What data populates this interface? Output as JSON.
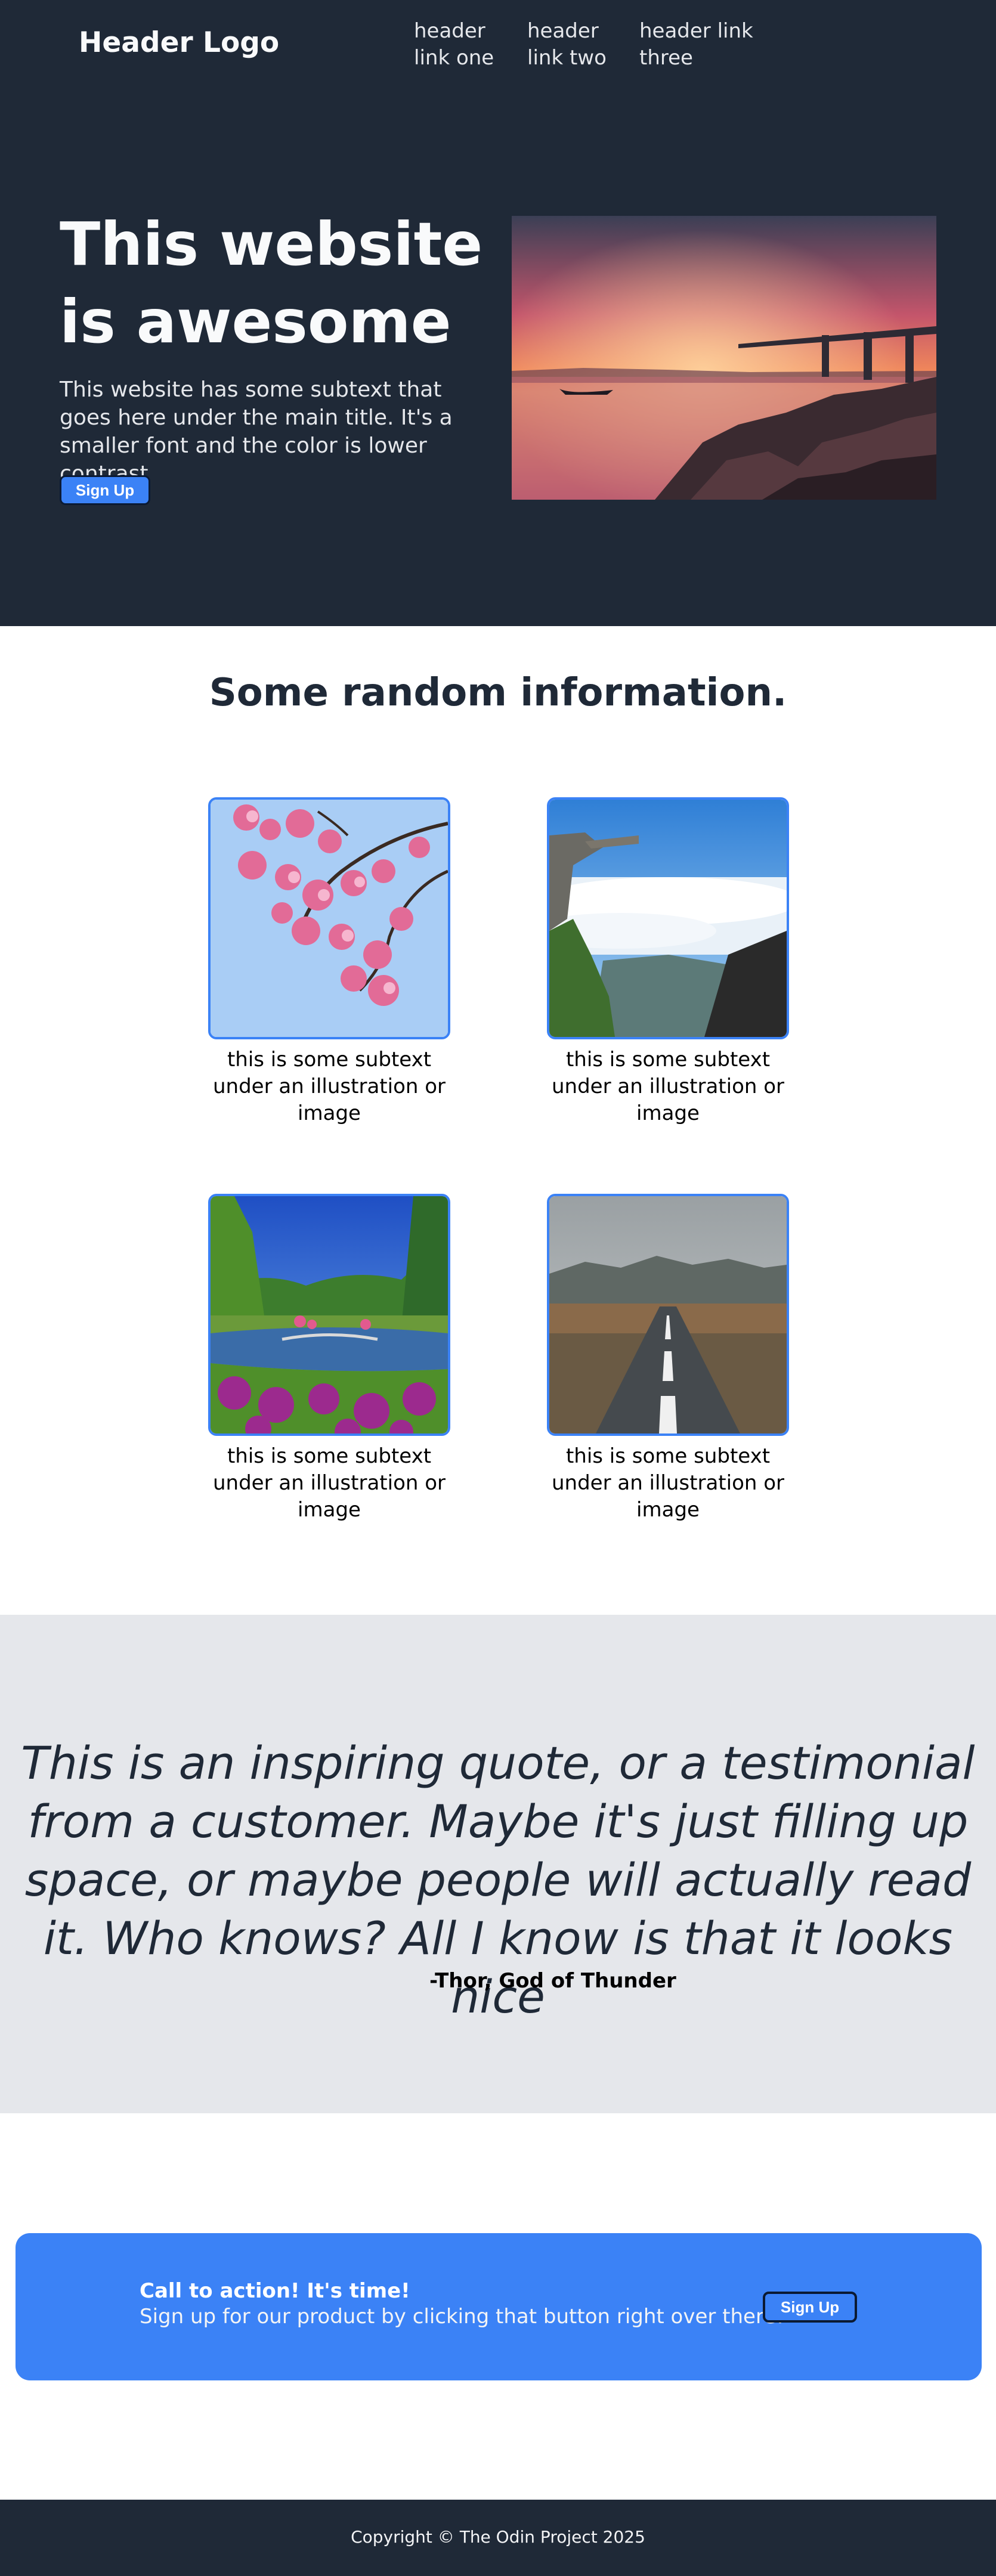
{
  "header": {
    "logo": "Header Logo",
    "nav_links": [
      "header link one",
      "header link two",
      "header link three"
    ]
  },
  "hero": {
    "title": "This website is awesome",
    "subtitle": "This website has some subtext that goes here under the main title. It's a smaller font and the color is lower contrast",
    "button_label": "Sign Up"
  },
  "info": {
    "title": "Some random information.",
    "cards": [
      {
        "caption": "this is some subtext under an illustration or image"
      },
      {
        "caption": "this is some subtext under an illustration or image"
      },
      {
        "caption": "this is some subtext under an illustration or image"
      },
      {
        "caption": "this is some subtext under an illustration or image"
      }
    ]
  },
  "quote": {
    "text": "This is an inspiring quote, or a testimonial from a customer. Maybe it's just filling up space, or maybe people will actually read it. Who knows? All I know is that it looks nice",
    "author": "-Thor, God of Thunder"
  },
  "cta": {
    "title": "Call to action! It's time!",
    "subtitle": "Sign up for our product by clicking that button right over there!",
    "button_label": "Sign Up"
  },
  "footer": {
    "copyright": "Copyright © The Odin Project 2025"
  },
  "colors": {
    "dark": "#1f2937",
    "accent": "#3b82f6",
    "light_gray": "#e5e7eb"
  }
}
